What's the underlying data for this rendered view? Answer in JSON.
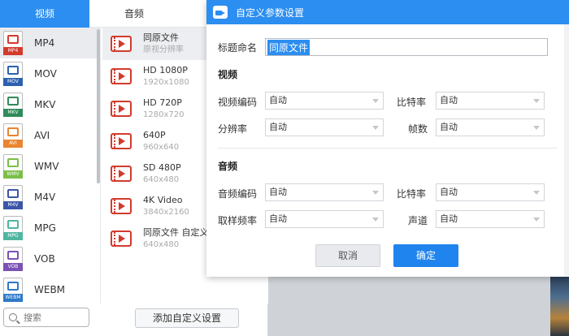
{
  "tabs": [
    {
      "label": "视频",
      "active": true
    },
    {
      "label": "音频",
      "active": false
    }
  ],
  "formats": [
    {
      "label": "MP4",
      "tag": "MP4",
      "color": "#d23b2c",
      "selected": true
    },
    {
      "label": "MOV",
      "tag": "MOV",
      "color": "#2d5fb0",
      "selected": false
    },
    {
      "label": "MKV",
      "tag": "MKV",
      "color": "#2f8b5a",
      "selected": false
    },
    {
      "label": "AVI",
      "tag": "AVI",
      "color": "#e9852f",
      "selected": false
    },
    {
      "label": "WMV",
      "tag": "WMV",
      "color": "#7bbf4a",
      "selected": false
    },
    {
      "label": "M4V",
      "tag": "M4V",
      "color": "#3b55a8",
      "selected": false
    },
    {
      "label": "MPG",
      "tag": "MPG",
      "color": "#4fb6a0",
      "selected": false
    },
    {
      "label": "VOB",
      "tag": "VOB",
      "color": "#7a52b3",
      "selected": false
    },
    {
      "label": "WEBM",
      "tag": "WEBM",
      "color": "#2c78c9",
      "selected": false
    }
  ],
  "search": {
    "placeholder": "搜索"
  },
  "presets": [
    {
      "name": "同原文件",
      "res": "原视分辨率",
      "selected": true
    },
    {
      "name": "HD 1080P",
      "res": "1920x1080",
      "selected": false
    },
    {
      "name": "HD 720P",
      "res": "1280x720",
      "selected": false
    },
    {
      "name": "640P",
      "res": "960x640",
      "selected": false
    },
    {
      "name": "SD 480P",
      "res": "640x480",
      "selected": false
    },
    {
      "name": "4K Video",
      "res": "3840x2160",
      "selected": false
    },
    {
      "name": "同原文件 自定义",
      "res": "640x480",
      "selected": false
    }
  ],
  "add_custom_label": "添加自定义设置",
  "dialog": {
    "title": "自定义参数设置",
    "title_label": "标题命名",
    "title_value": "同原文件",
    "video_section": "视频",
    "audio_section": "音频",
    "video_fields": {
      "codec_label": "视频编码",
      "codec_value": "自动",
      "bitrate_label": "比特率",
      "bitrate_value": "自动",
      "resolution_label": "分辨率",
      "resolution_value": "自动",
      "framerate_label": "帧数",
      "framerate_value": "自动"
    },
    "audio_fields": {
      "codec_label": "音频编码",
      "codec_value": "自动",
      "bitrate_label": "比特率",
      "bitrate_value": "自动",
      "samplerate_label": "取样频率",
      "samplerate_value": "自动",
      "channel_label": "声道",
      "channel_value": "自动"
    },
    "cancel_label": "取消",
    "ok_label": "确定"
  },
  "colors": {
    "accent": "#2b8ef0",
    "preset_icon": "#d23b2c"
  }
}
